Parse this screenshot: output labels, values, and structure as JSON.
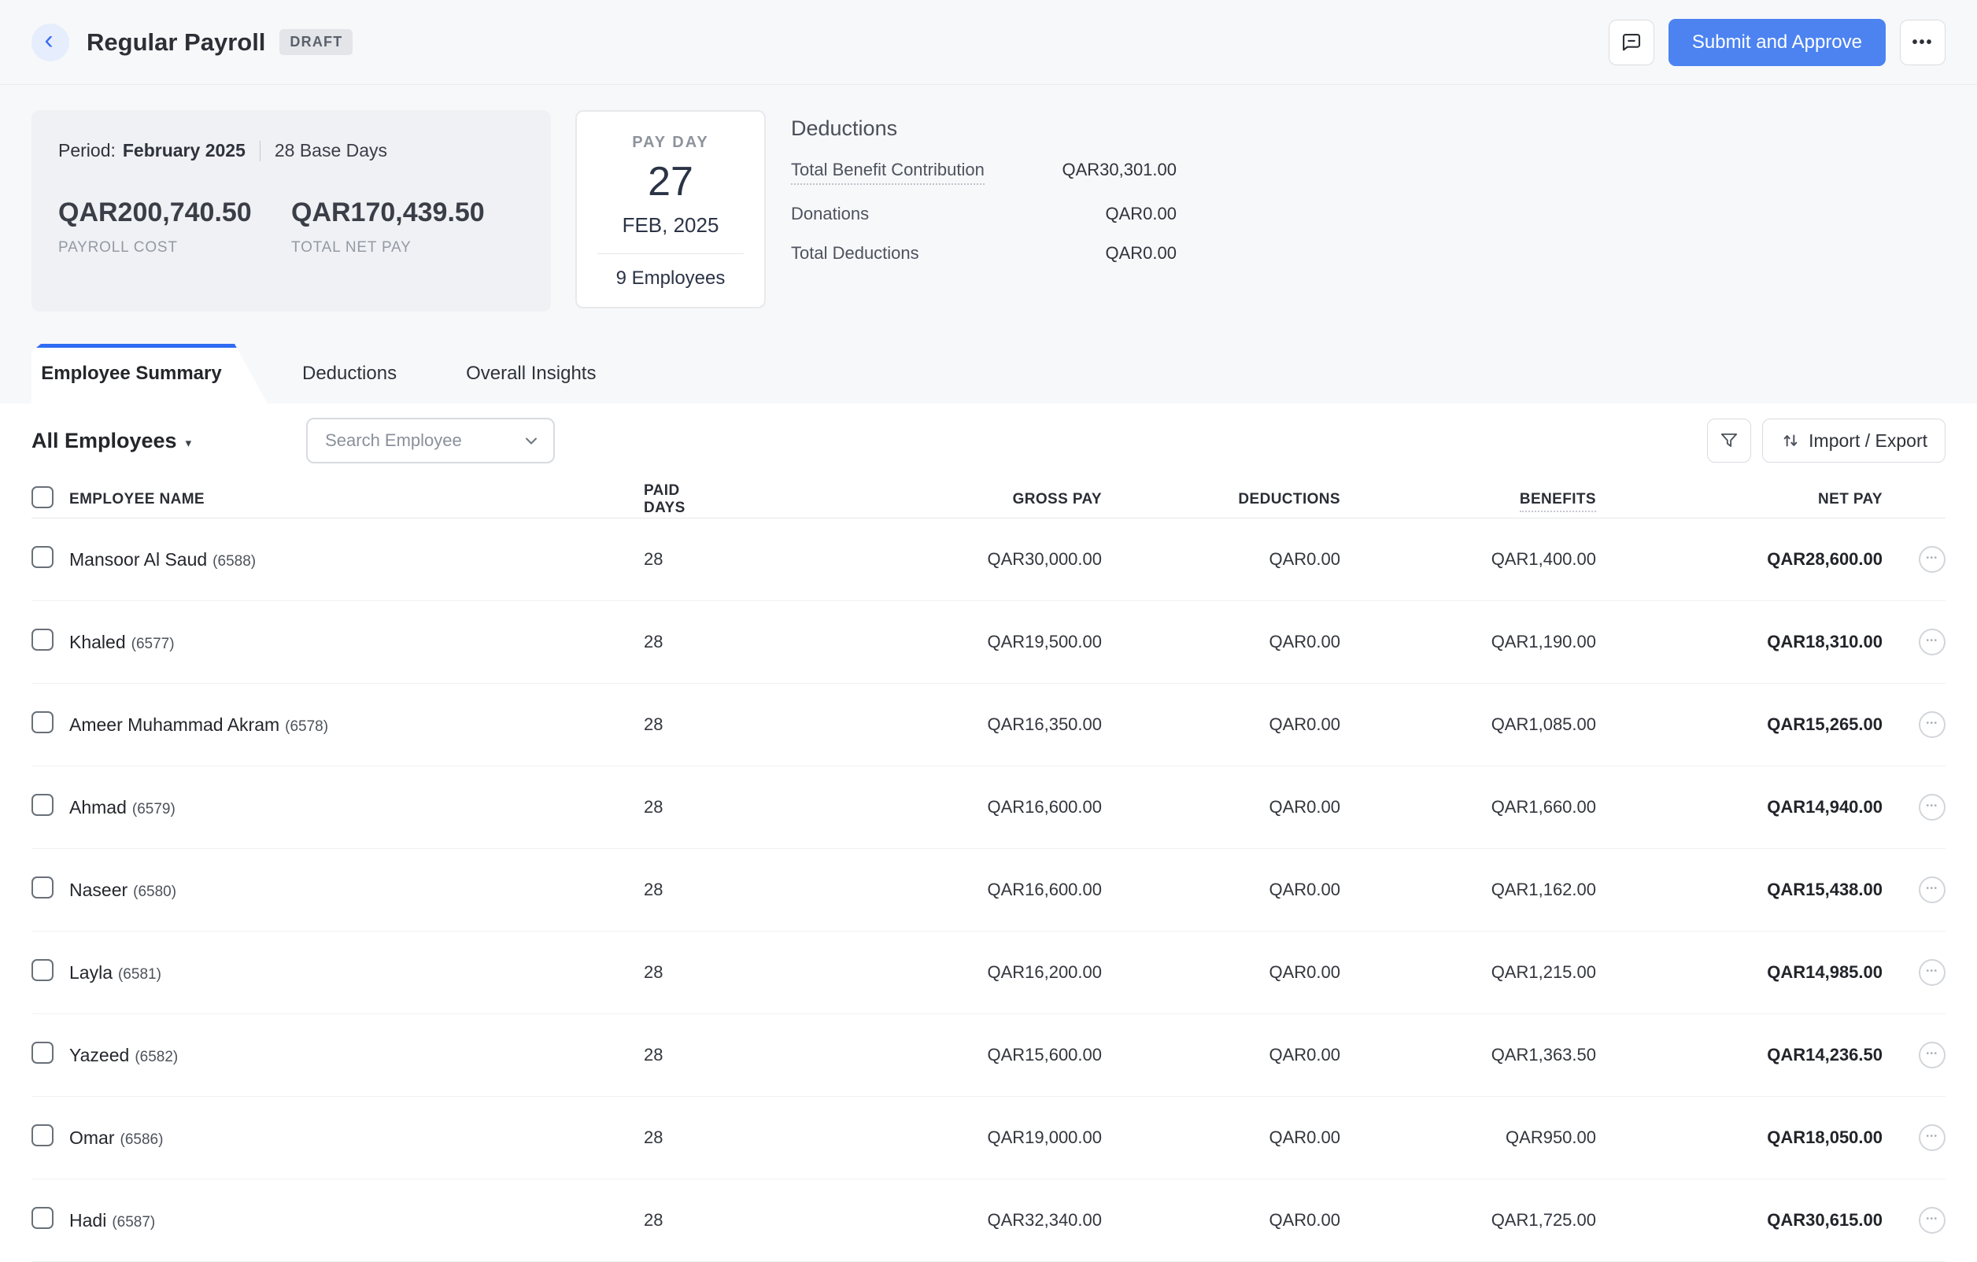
{
  "glyphs": {
    "back": "‹",
    "more": "•••",
    "caret_down": "▾",
    "row_menu": "•••"
  },
  "colors": {
    "primary_button": "#4c83f1",
    "active_tab_border": "#2f6cf3",
    "top_section_bg": "#f7f8fa",
    "summary_card_bg": "#f0f1f4",
    "badge_bg": "#e3e5e9",
    "badge_text": "#5a606c",
    "back_button_bg": "#e6edfc",
    "back_chevron": "#3a6df0"
  },
  "header": {
    "title": "Regular Payroll",
    "status_badge": "DRAFT",
    "submit_label": "Submit and Approve"
  },
  "summary": {
    "period_label": "Period:",
    "period_value": "February 2025",
    "base_days": "28 Base Days",
    "payroll_cost": "QAR200,740.50",
    "payroll_cost_label": "PAYROLL COST",
    "total_net_pay": "QAR170,439.50",
    "total_net_pay_label": "TOTAL NET PAY"
  },
  "payday": {
    "label": "PAY DAY",
    "day": "27",
    "month_year": "FEB, 2025",
    "employee_count": "9 Employees"
  },
  "deductions_panel": {
    "title": "Deductions",
    "rows": [
      {
        "label": "Total Benefit Contribution",
        "value": "QAR30,301.00"
      },
      {
        "label": "Donations",
        "value": "QAR0.00"
      },
      {
        "label": "Total Deductions",
        "value": "QAR0.00"
      }
    ]
  },
  "tabs": [
    {
      "label": "Employee Summary",
      "active": true
    },
    {
      "label": "Deductions",
      "active": false
    },
    {
      "label": "Overall Insights",
      "active": false
    }
  ],
  "toolbar": {
    "employee_filter": "All Employees",
    "search_placeholder": "Search Employee",
    "import_export": "Import / Export"
  },
  "table": {
    "columns": [
      "EMPLOYEE NAME",
      "PAID DAYS",
      "GROSS PAY",
      "DEDUCTIONS",
      "BENEFITS",
      "NET PAY"
    ],
    "rows": [
      {
        "name": "Mansoor Al Saud",
        "id": "(6588)",
        "paid_days": "28",
        "gross": "QAR30,000.00",
        "deductions": "QAR0.00",
        "benefits": "QAR1,400.00",
        "net": "QAR28,600.00"
      },
      {
        "name": "Khaled",
        "id": "(6577)",
        "paid_days": "28",
        "gross": "QAR19,500.00",
        "deductions": "QAR0.00",
        "benefits": "QAR1,190.00",
        "net": "QAR18,310.00"
      },
      {
        "name": "Ameer Muhammad Akram",
        "id": "(6578)",
        "paid_days": "28",
        "gross": "QAR16,350.00",
        "deductions": "QAR0.00",
        "benefits": "QAR1,085.00",
        "net": "QAR15,265.00"
      },
      {
        "name": "Ahmad",
        "id": "(6579)",
        "paid_days": "28",
        "gross": "QAR16,600.00",
        "deductions": "QAR0.00",
        "benefits": "QAR1,660.00",
        "net": "QAR14,940.00"
      },
      {
        "name": "Naseer",
        "id": "(6580)",
        "paid_days": "28",
        "gross": "QAR16,600.00",
        "deductions": "QAR0.00",
        "benefits": "QAR1,162.00",
        "net": "QAR15,438.00"
      },
      {
        "name": "Layla",
        "id": "(6581)",
        "paid_days": "28",
        "gross": "QAR16,200.00",
        "deductions": "QAR0.00",
        "benefits": "QAR1,215.00",
        "net": "QAR14,985.00"
      },
      {
        "name": "Yazeed",
        "id": "(6582)",
        "paid_days": "28",
        "gross": "QAR15,600.00",
        "deductions": "QAR0.00",
        "benefits": "QAR1,363.50",
        "net": "QAR14,236.50"
      },
      {
        "name": "Omar",
        "id": "(6586)",
        "paid_days": "28",
        "gross": "QAR19,000.00",
        "deductions": "QAR0.00",
        "benefits": "QAR950.00",
        "net": "QAR18,050.00"
      },
      {
        "name": "Hadi",
        "id": "(6587)",
        "paid_days": "28",
        "gross": "QAR32,340.00",
        "deductions": "QAR0.00",
        "benefits": "QAR1,725.00",
        "net": "QAR30,615.00"
      }
    ]
  }
}
